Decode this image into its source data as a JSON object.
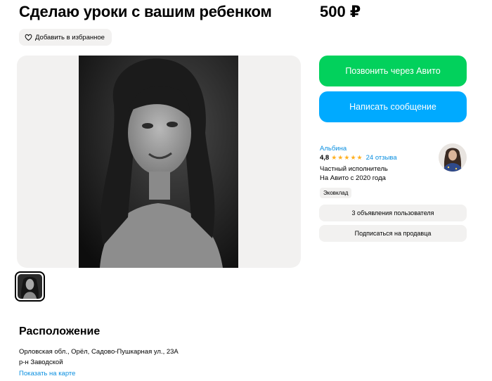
{
  "listing": {
    "title": "Сделаю уроки с вашим ребенком",
    "price": "500 ₽",
    "favorite_label": "Добавить в избранное"
  },
  "actions": {
    "call_label": "Позвонить через Авито",
    "message_label": "Написать сообщение"
  },
  "seller": {
    "name": "Альбина",
    "rating": "4,8",
    "stars": 5,
    "reviews": "24 отзыва",
    "type": "Частный исполнитель",
    "since": "На Авито с 2020 года",
    "badge": "Эковклад",
    "listings_label": "3 объявления пользователя",
    "subscribe_label": "Подписаться на продавца"
  },
  "location": {
    "heading": "Расположение",
    "address": "Орловская обл., Орёл, Садово-Пушкарная ул., 23А",
    "district": "р-н Заводской",
    "map_link": "Показать на карте"
  },
  "colors": {
    "call_green": "#02d15c",
    "message_blue": "#00aaff",
    "link_blue": "#0a8fe0",
    "star_yellow": "#ffb021",
    "surface_gray": "#f2f1f0"
  }
}
